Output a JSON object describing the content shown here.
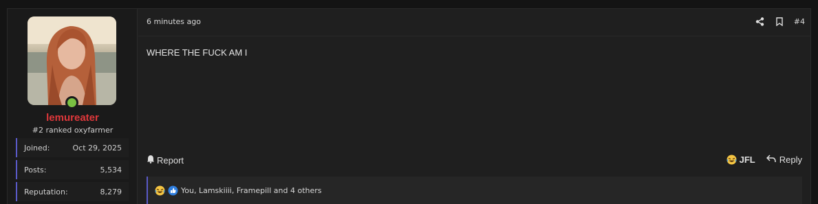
{
  "user": {
    "username": "lemureater",
    "title": "#2 ranked oxyfarmer",
    "online": true,
    "stats": [
      {
        "label": "Joined:",
        "value": "Oct 29, 2025"
      },
      {
        "label": "Posts:",
        "value": "5,534"
      },
      {
        "label": "Reputation:",
        "value": "8,279"
      }
    ]
  },
  "post": {
    "timestamp": "6 minutes ago",
    "number": "#4",
    "message": "WHERE THE FUCK AM I"
  },
  "actions": {
    "report_label": "Report",
    "jfl_label": "JFL",
    "reply_label": "Reply"
  },
  "reactions": {
    "text": "You, Lamskiiii, Framepill and 4 others"
  },
  "colors": {
    "username": "#e0383b",
    "accent_border": "#5a5ac8",
    "online": "#7ac142"
  },
  "icons": [
    "share-icon",
    "bookmark-icon",
    "bell-icon",
    "laughing-emoji-icon",
    "reply-icon",
    "thumbs-up-icon"
  ]
}
